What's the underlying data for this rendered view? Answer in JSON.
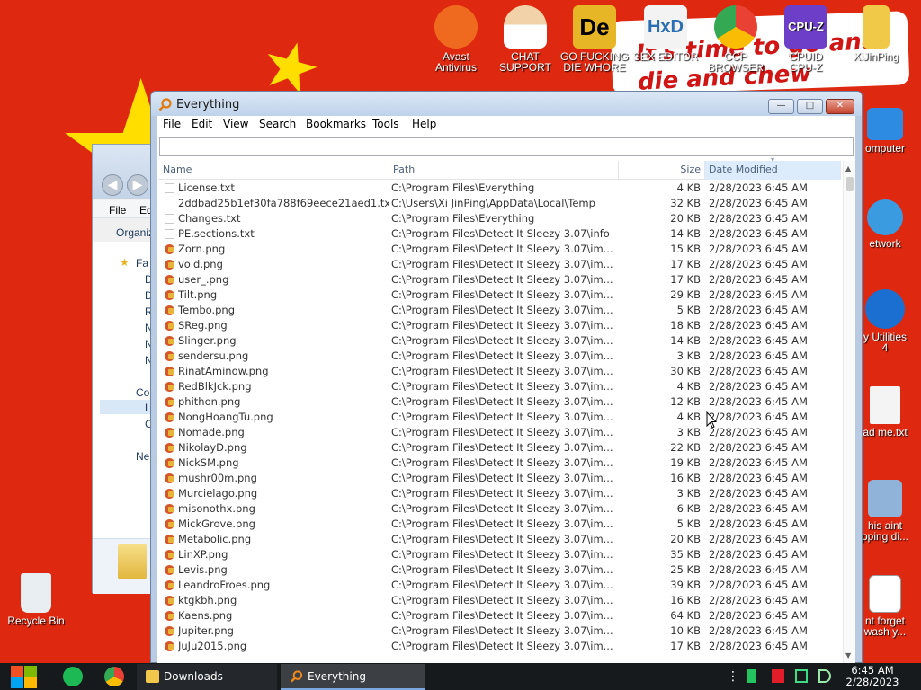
{
  "desktop": {
    "wallpaper_text": "It's time to go and die and chew",
    "icons": [
      {
        "label": "Avast\nAntivirus",
        "icon": "avast-icon",
        "color": "#ef6a1f"
      },
      {
        "label": "CHAT\nSUPPORT",
        "icon": "doctor-icon",
        "color": "#f2d2a9"
      },
      {
        "label": "GO FUCKING\nDIE WHORE",
        "icon": "die-icon",
        "color": "#e7b627"
      },
      {
        "label": "SEX EDITOR",
        "icon": "hxd-icon",
        "color": "#f3f3f3"
      },
      {
        "label": "CCP\nBROWSER",
        "icon": "chrome-icon",
        "color": "#3b8ee6"
      },
      {
        "label": "CPUID\nCPU-Z",
        "icon": "cpuz-icon",
        "color": "#6d3ec7"
      },
      {
        "label": "XiJinPing",
        "icon": "user-folder-icon",
        "color": "#f0c948"
      },
      {
        "label": "omputer",
        "icon": "computer-icon",
        "color": "#2d8be1"
      },
      {
        "label": "etwork",
        "icon": "network-icon",
        "color": "#3a9be0"
      },
      {
        "label": "y Utilities\n4",
        "icon": "ccleaner-icon",
        "color": "#1a6fd1"
      },
      {
        "label": "ad me.txt",
        "icon": "textfile-icon",
        "color": "#f4f4f4"
      },
      {
        "label": "his aint\npping di...",
        "icon": "drive-icon",
        "color": "#8fb3d9"
      },
      {
        "label": "nt forget\nwash y...",
        "icon": "calendar-icon",
        "color": "#ffffff"
      },
      {
        "label": "Recycle Bin",
        "icon": "recycle-bin-icon",
        "color": "#e9eef2"
      }
    ]
  },
  "explorer_bg": {
    "menu_label": "File",
    "menu_label2": "Ed",
    "organize_label": "Organiz",
    "fav_label": "Fa",
    "comp_label": "Co",
    "net_label": "Ne",
    "items": [
      "D",
      "D",
      "R",
      "N",
      "N",
      "N",
      "L",
      "C"
    ]
  },
  "everything": {
    "title": "Everything",
    "menus": [
      "File",
      "Edit",
      "View",
      "Search",
      "Bookmarks",
      "Tools",
      "Help"
    ],
    "search_value": "",
    "columns": {
      "name": "Name",
      "path": "Path",
      "size": "Size",
      "date": "Date Modified"
    },
    "rows": [
      {
        "name": "License.txt",
        "path": "C:\\Program Files\\Everything",
        "size": "4 KB",
        "date": "2/28/2023 6:45 AM",
        "type": "txt"
      },
      {
        "name": "2ddbad25b1ef30fa788f69eece21aed1.txt",
        "path": "C:\\Users\\Xi JinPing\\AppData\\Local\\Temp",
        "size": "32 KB",
        "date": "2/28/2023 6:45 AM",
        "type": "txt"
      },
      {
        "name": "Changes.txt",
        "path": "C:\\Program Files\\Everything",
        "size": "20 KB",
        "date": "2/28/2023 6:45 AM",
        "type": "txt"
      },
      {
        "name": "PE.sections.txt",
        "path": "C:\\Program Files\\Detect It Sleezy 3.07\\info",
        "size": "14 KB",
        "date": "2/28/2023 6:45 AM",
        "type": "txt"
      },
      {
        "name": "Zorn.png",
        "path": "C:\\Program Files\\Detect It Sleezy 3.07\\im...",
        "size": "15 KB",
        "date": "2/28/2023 6:45 AM",
        "type": "png"
      },
      {
        "name": "void.png",
        "path": "C:\\Program Files\\Detect It Sleezy 3.07\\im...",
        "size": "17 KB",
        "date": "2/28/2023 6:45 AM",
        "type": "png"
      },
      {
        "name": "user_.png",
        "path": "C:\\Program Files\\Detect It Sleezy 3.07\\im...",
        "size": "17 KB",
        "date": "2/28/2023 6:45 AM",
        "type": "png"
      },
      {
        "name": "Tilt.png",
        "path": "C:\\Program Files\\Detect It Sleezy 3.07\\im...",
        "size": "29 KB",
        "date": "2/28/2023 6:45 AM",
        "type": "png"
      },
      {
        "name": "Tembo.png",
        "path": "C:\\Program Files\\Detect It Sleezy 3.07\\im...",
        "size": "5 KB",
        "date": "2/28/2023 6:45 AM",
        "type": "png"
      },
      {
        "name": "SReg.png",
        "path": "C:\\Program Files\\Detect It Sleezy 3.07\\im...",
        "size": "18 KB",
        "date": "2/28/2023 6:45 AM",
        "type": "png"
      },
      {
        "name": "Slinger.png",
        "path": "C:\\Program Files\\Detect It Sleezy 3.07\\im...",
        "size": "14 KB",
        "date": "2/28/2023 6:45 AM",
        "type": "png"
      },
      {
        "name": "sendersu.png",
        "path": "C:\\Program Files\\Detect It Sleezy 3.07\\im...",
        "size": "3 KB",
        "date": "2/28/2023 6:45 AM",
        "type": "png"
      },
      {
        "name": "RinatAminow.png",
        "path": "C:\\Program Files\\Detect It Sleezy 3.07\\im...",
        "size": "30 KB",
        "date": "2/28/2023 6:45 AM",
        "type": "png"
      },
      {
        "name": "RedBlkJck.png",
        "path": "C:\\Program Files\\Detect It Sleezy 3.07\\im...",
        "size": "4 KB",
        "date": "2/28/2023 6:45 AM",
        "type": "png"
      },
      {
        "name": "phithon.png",
        "path": "C:\\Program Files\\Detect It Sleezy 3.07\\im...",
        "size": "12 KB",
        "date": "2/28/2023 6:45 AM",
        "type": "png"
      },
      {
        "name": "NongHoangTu.png",
        "path": "C:\\Program Files\\Detect It Sleezy 3.07\\im...",
        "size": "4 KB",
        "date": "2/28/2023 6:45 AM",
        "type": "png"
      },
      {
        "name": "Nomade.png",
        "path": "C:\\Program Files\\Detect It Sleezy 3.07\\im...",
        "size": "3 KB",
        "date": "2/28/2023 6:45 AM",
        "type": "png"
      },
      {
        "name": "NikolayD.png",
        "path": "C:\\Program Files\\Detect It Sleezy 3.07\\im...",
        "size": "22 KB",
        "date": "2/28/2023 6:45 AM",
        "type": "png"
      },
      {
        "name": "NickSM.png",
        "path": "C:\\Program Files\\Detect It Sleezy 3.07\\im...",
        "size": "19 KB",
        "date": "2/28/2023 6:45 AM",
        "type": "png"
      },
      {
        "name": "mushr00m.png",
        "path": "C:\\Program Files\\Detect It Sleezy 3.07\\im...",
        "size": "16 KB",
        "date": "2/28/2023 6:45 AM",
        "type": "png"
      },
      {
        "name": "Murcielago.png",
        "path": "C:\\Program Files\\Detect It Sleezy 3.07\\im...",
        "size": "3 KB",
        "date": "2/28/2023 6:45 AM",
        "type": "png"
      },
      {
        "name": "misonothx.png",
        "path": "C:\\Program Files\\Detect It Sleezy 3.07\\im...",
        "size": "6 KB",
        "date": "2/28/2023 6:45 AM",
        "type": "png"
      },
      {
        "name": "MickGrove.png",
        "path": "C:\\Program Files\\Detect It Sleezy 3.07\\im...",
        "size": "5 KB",
        "date": "2/28/2023 6:45 AM",
        "type": "png"
      },
      {
        "name": "Metabolic.png",
        "path": "C:\\Program Files\\Detect It Sleezy 3.07\\im...",
        "size": "20 KB",
        "date": "2/28/2023 6:45 AM",
        "type": "png"
      },
      {
        "name": "LinXP.png",
        "path": "C:\\Program Files\\Detect It Sleezy 3.07\\im...",
        "size": "35 KB",
        "date": "2/28/2023 6:45 AM",
        "type": "png"
      },
      {
        "name": "Levis.png",
        "path": "C:\\Program Files\\Detect It Sleezy 3.07\\im...",
        "size": "25 KB",
        "date": "2/28/2023 6:45 AM",
        "type": "png"
      },
      {
        "name": "LeandroFroes.png",
        "path": "C:\\Program Files\\Detect It Sleezy 3.07\\im...",
        "size": "39 KB",
        "date": "2/28/2023 6:45 AM",
        "type": "png"
      },
      {
        "name": "ktgkbh.png",
        "path": "C:\\Program Files\\Detect It Sleezy 3.07\\im...",
        "size": "16 KB",
        "date": "2/28/2023 6:45 AM",
        "type": "png"
      },
      {
        "name": "Kaens.png",
        "path": "C:\\Program Files\\Detect It Sleezy 3.07\\im...",
        "size": "64 KB",
        "date": "2/28/2023 6:45 AM",
        "type": "png"
      },
      {
        "name": "Jupiter.png",
        "path": "C:\\Program Files\\Detect It Sleezy 3.07\\im...",
        "size": "10 KB",
        "date": "2/28/2023 6:45 AM",
        "type": "png"
      },
      {
        "name": "JuJu2015.png",
        "path": "C:\\Program Files\\Detect It Sleezy 3.07\\im...",
        "size": "17 KB",
        "date": "2/28/2023 6:45 AM",
        "type": "png"
      }
    ]
  },
  "taskbar": {
    "tasks": [
      {
        "label": "Downloads",
        "icon": "folder-icon",
        "active": false
      },
      {
        "label": "Everything",
        "icon": "everything-search-icon",
        "active": true
      }
    ],
    "clock_time": "6:45 AM",
    "clock_date": "2/28/2023"
  },
  "colors": {
    "wallpaper_red": "#de2910",
    "star_yellow": "#ffde00",
    "taskbar_bg": "#161a1d",
    "accent_blue": "#7aa7e0"
  }
}
